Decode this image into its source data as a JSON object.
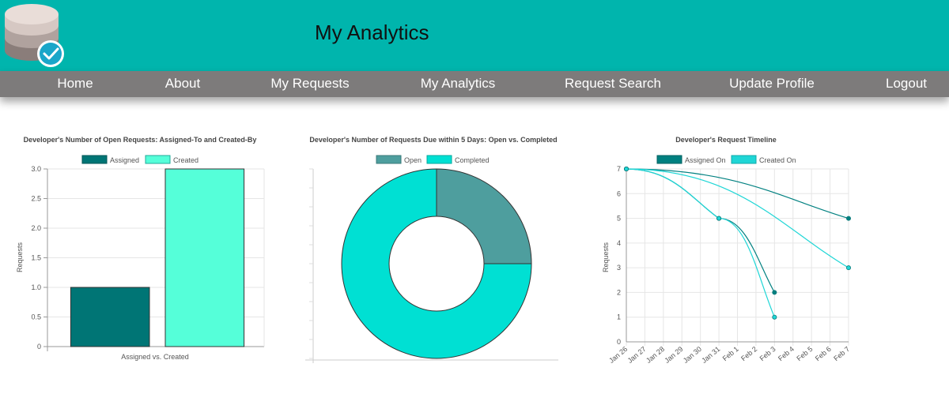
{
  "header": {
    "title": "My Analytics",
    "logo_icon": "database-check-icon"
  },
  "nav": {
    "items": [
      "Home",
      "About",
      "My Requests",
      "My Analytics",
      "Request Search",
      "Update Profile",
      "Logout"
    ]
  },
  "colors": {
    "header_bg": "#00b5ad",
    "nav_bg": "#7d7b7b",
    "dark_teal": "#007575",
    "light_aqua": "#55ffd9",
    "open_teal": "#4e9e9e",
    "cyan": "#00e0d3"
  },
  "chart_data": [
    {
      "type": "bar",
      "title": "Developer's Number of Open Requests: Assigned-To and Created-By",
      "xlabel": "Assigned vs. Created",
      "ylabel": "Requests",
      "ylim": [
        0,
        3
      ],
      "yticks": [
        "0",
        "0.5",
        "1.0",
        "1.5",
        "2.0",
        "2.5",
        "3.0"
      ],
      "series": [
        {
          "name": "Assigned",
          "values": [
            1
          ],
          "color": "#007575"
        },
        {
          "name": "Created",
          "values": [
            3
          ],
          "color": "#55ffd9"
        }
      ]
    },
    {
      "type": "pie",
      "title": "Developer's Number of Requests Due within 5 Days: Open vs. Completed",
      "labels": [
        "Open",
        "Completed"
      ],
      "values": [
        1,
        3
      ],
      "colors": [
        "#4e9e9e",
        "#00e0d3"
      ]
    },
    {
      "type": "line",
      "title": "Developer's Request Timeline",
      "ylabel": "Requests",
      "ylim": [
        0,
        7
      ],
      "yticks": [
        "0",
        "1",
        "2",
        "3",
        "4",
        "5",
        "6",
        "7"
      ],
      "x": [
        "Jan 26",
        "Jan 27",
        "Jan 28",
        "Jan 29",
        "Jan 30",
        "Jan 31",
        "Feb 1",
        "Feb 2",
        "Feb 3",
        "Feb 4",
        "Feb 5",
        "Feb 6",
        "Feb 7"
      ],
      "series": [
        {
          "name": "Assigned On",
          "color": "#008080",
          "lines": [
            [
              [
                "Jan 26",
                7
              ],
              [
                "Feb 7",
                5
              ]
            ],
            [
              [
                "Jan 26",
                7
              ],
              [
                "Jan 31",
                5
              ],
              [
                "Feb 3",
                2
              ]
            ]
          ]
        },
        {
          "name": "Created On",
          "color": "#1fd6d6",
          "lines": [
            [
              [
                "Jan 26",
                7
              ],
              [
                "Feb 7",
                3
              ]
            ],
            [
              [
                "Jan 26",
                7
              ],
              [
                "Jan 31",
                5
              ],
              [
                "Feb 3",
                1
              ]
            ]
          ]
        }
      ]
    }
  ]
}
